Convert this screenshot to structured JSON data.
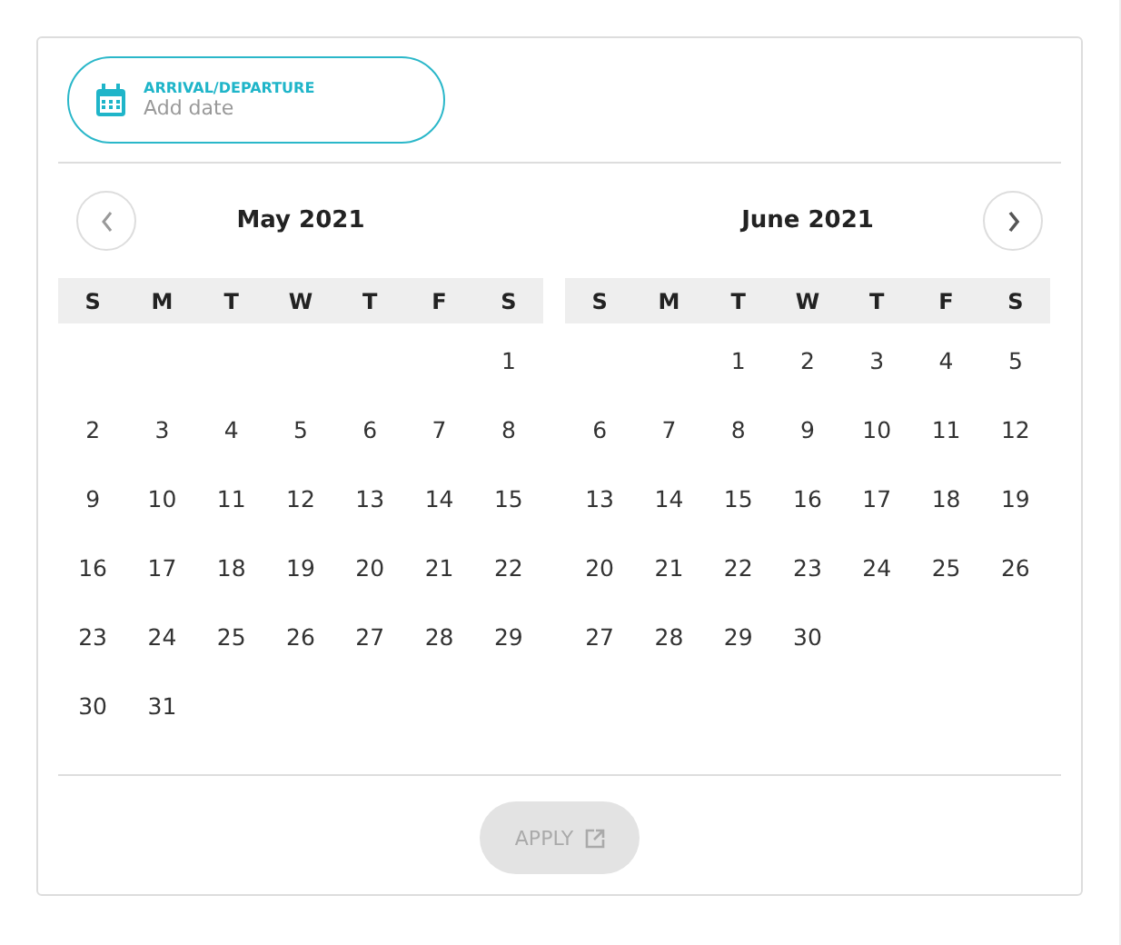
{
  "date_field": {
    "label": "ARRIVAL/DEPARTURE",
    "placeholder": "Add date"
  },
  "months": [
    {
      "title": "May 2021",
      "weekdays": [
        "S",
        "M",
        "T",
        "W",
        "T",
        "F",
        "S"
      ],
      "weeks": [
        [
          "1"
        ],
        [
          "2",
          "3",
          "4",
          "5",
          "6",
          "7",
          "8"
        ],
        [
          "9",
          "10",
          "11",
          "12",
          "13",
          "14",
          "15"
        ],
        [
          "16",
          "17",
          "18",
          "19",
          "20",
          "21",
          "22"
        ],
        [
          "23",
          "24",
          "25",
          "26",
          "27",
          "28",
          "29"
        ],
        [
          "30",
          "31"
        ]
      ]
    },
    {
      "title": "June 2021",
      "weekdays": [
        "S",
        "M",
        "T",
        "W",
        "T",
        "F",
        "S"
      ],
      "weeks": [
        [
          "1",
          "2",
          "3",
          "4",
          "5"
        ],
        [
          "6",
          "7",
          "8",
          "9",
          "10",
          "11",
          "12"
        ],
        [
          "13",
          "14",
          "15",
          "16",
          "17",
          "18",
          "19"
        ],
        [
          "20",
          "21",
          "22",
          "23",
          "24",
          "25",
          "26"
        ],
        [
          "27",
          "28",
          "29",
          "30"
        ]
      ]
    }
  ],
  "apply_button": {
    "label": "APPLY",
    "disabled": true
  }
}
